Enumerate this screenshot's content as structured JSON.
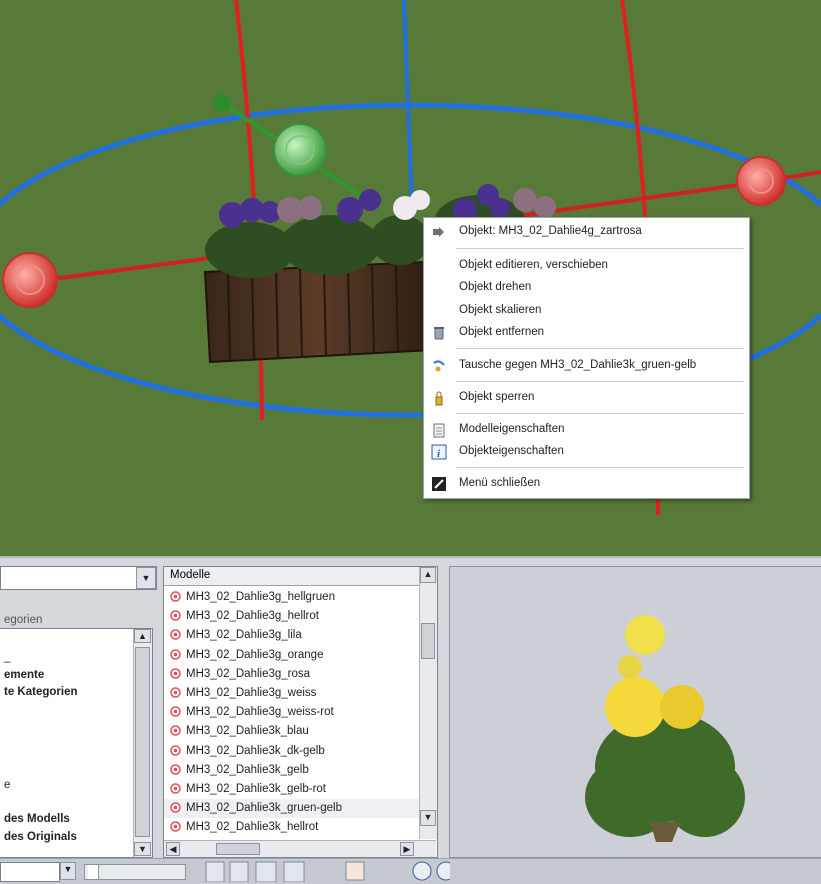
{
  "context_menu": {
    "title": "Objekt: MH3_02_Dahlie4g_zartrosa",
    "edit_move": "Objekt editieren, verschieben",
    "rotate": "Objekt drehen",
    "scale": "Objekt skalieren",
    "remove": "Objekt entfernen",
    "swap": "Tausche gegen MH3_02_Dahlie3k_gruen-gelb",
    "lock": "Objekt sperren",
    "model_properties": "Modelleigenschaften",
    "object_properties": "Objekteigenschaften",
    "close": "Menü schließen"
  },
  "left_panel": {
    "dropdown_value": "",
    "categories_label": "egorien",
    "items": [
      "_",
      "emente",
      "te Kategorien",
      "e",
      "des Modells",
      "des Originals"
    ]
  },
  "models": {
    "header": "Modelle",
    "items": [
      "MH3_02_Dahlie3g_hellgruen",
      "MH3_02_Dahlie3g_hellrot",
      "MH3_02_Dahlie3g_lila",
      "MH3_02_Dahlie3g_orange",
      "MH3_02_Dahlie3g_rosa",
      "MH3_02_Dahlie3g_weiss",
      "MH3_02_Dahlie3g_weiss-rot",
      "MH3_02_Dahlie3k_blau",
      "MH3_02_Dahlie3k_dk-gelb",
      "MH3_02_Dahlie3k_gelb",
      "MH3_02_Dahlie3k_gelb-rot",
      "MH3_02_Dahlie3k_gruen-gelb",
      "MH3_02_Dahlie3k_hellrot"
    ],
    "selected": "MH3_02_Dahlie3k_gruen-gelb"
  },
  "colors": {
    "grass": "#5d7f3b",
    "axis_red": "#e02020",
    "axis_blue": "#1f6fe0",
    "axis_green": "#2e9a2e",
    "flower_icon": "#e0505a"
  },
  "icons": [
    "arrow-icon",
    "trash-icon",
    "swap-icon",
    "lock-icon",
    "document-icon",
    "info-icon",
    "close-icon",
    "flower-icon",
    "dropdown-arrow-icon",
    "zoom-in-icon",
    "zoom-out-icon"
  ]
}
